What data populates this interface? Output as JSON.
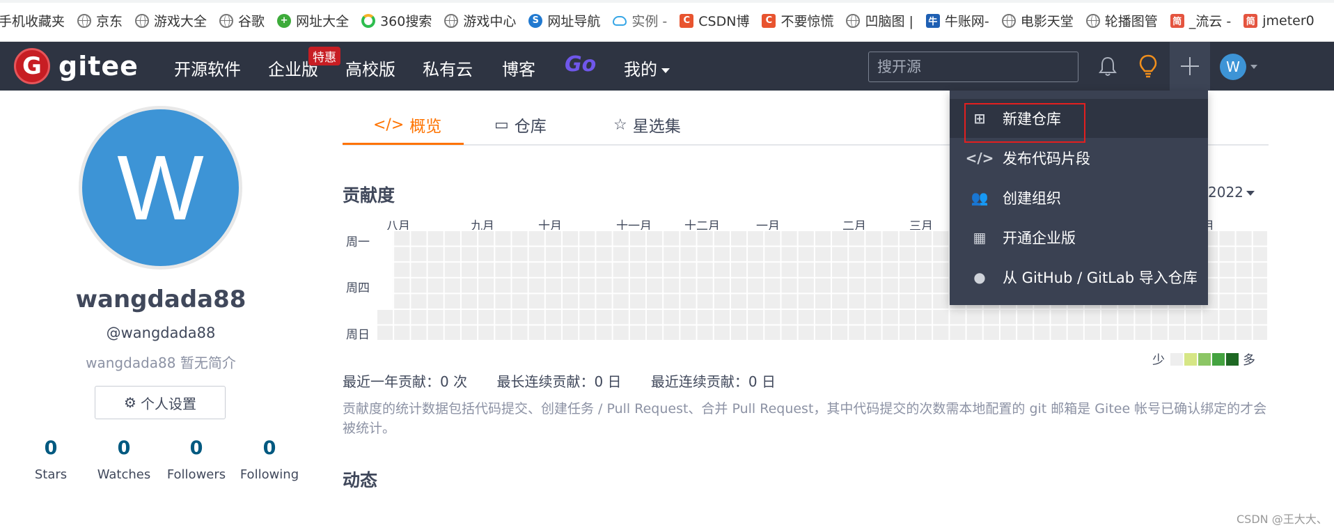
{
  "bookmarks": [
    {
      "label": "手机收藏夹",
      "icon": "none"
    },
    {
      "label": "京东",
      "icon": "globe-icon"
    },
    {
      "label": "游戏大全",
      "icon": "globe-icon"
    },
    {
      "label": "谷歌",
      "icon": "globe-icon"
    },
    {
      "label": "网址大全",
      "icon": "green-plus-icon"
    },
    {
      "label": "360搜索",
      "icon": "360-search-icon"
    },
    {
      "label": "游戏中心",
      "icon": "globe-icon"
    },
    {
      "label": "网址导航",
      "icon": "nav-icon"
    },
    {
      "label": "实例 -",
      "icon": "cloud-icon"
    },
    {
      "label": "CSDN博",
      "icon": "csdn-icon"
    },
    {
      "label": "不要惊慌",
      "icon": "csdn-icon"
    },
    {
      "label": "凹脑图 |",
      "icon": "globe-icon"
    },
    {
      "label": "牛账网-",
      "icon": "niuzhang-icon"
    },
    {
      "label": "电影天堂",
      "icon": "globe-icon"
    },
    {
      "label": "轮播图管",
      "icon": "globe-icon"
    },
    {
      "label": "_流云 -",
      "icon": "jian-icon"
    },
    {
      "label": "jmeter0",
      "icon": "jian-icon"
    }
  ],
  "nav": {
    "logo_letter": "G",
    "logo_text": "gitee",
    "items": [
      "开源软件",
      "企业版",
      "高校版",
      "私有云",
      "博客",
      "Go",
      "我的"
    ],
    "badge": "特惠",
    "search_placeholder": "搜开源",
    "avatar_letter": "W",
    "colors": {
      "bar": "#2e3442",
      "accent": "#fe7300",
      "brand": "#c71d23"
    }
  },
  "profile": {
    "avatar_letter": "W",
    "username": "wangdada88",
    "handle": "@wangdada88",
    "bio": "wangdada88 暂无简介",
    "settings_label": "个人设置",
    "stats": [
      {
        "value": "0",
        "label": "Stars"
      },
      {
        "value": "0",
        "label": "Watches"
      },
      {
        "value": "0",
        "label": "Followers"
      },
      {
        "value": "0",
        "label": "Following"
      }
    ]
  },
  "tabs": [
    {
      "label": "概览",
      "icon": "code-window-icon",
      "active": true
    },
    {
      "label": "仓库",
      "icon": "stack-icon",
      "active": false
    },
    {
      "label": "星选集",
      "icon": "star-box-icon",
      "active": false
    }
  ],
  "contribution": {
    "title": "贡献度",
    "year": "2022",
    "months": [
      "八月",
      "九月",
      "十月",
      "十一月",
      "十二月",
      "一月",
      "二月",
      "三月",
      "月"
    ],
    "weekdays": [
      "周一",
      "周四",
      "周日"
    ],
    "legend_less": "少",
    "legend_more": "多",
    "legend_colors": [
      "#eeeeee",
      "#d6e685",
      "#8cc665",
      "#44a340",
      "#1e6823"
    ],
    "stats": [
      "最近一年贡献：0 次",
      "最长连续贡献：0 日",
      "最近连续贡献：0 日"
    ],
    "note": "贡献度的统计数据包括代码提交、创建任务 / Pull Request、合并 Pull Request，其中代码提交的次数需本地配置的 git 邮箱是 Gitee 帐号已确认绑定的才会被统计。"
  },
  "activity_title": "动态",
  "dropdown": {
    "items": [
      {
        "label": "新建仓库",
        "icon": "plus-square-icon"
      },
      {
        "label": "发布代码片段",
        "icon": "code-icon"
      },
      {
        "label": "创建组织",
        "icon": "users-icon"
      },
      {
        "label": "开通企业版",
        "icon": "building-icon"
      },
      {
        "label": "从 GitHub / GitLab 导入仓库",
        "icon": "github-icon"
      }
    ]
  },
  "watermark": "CSDN @王大大、"
}
